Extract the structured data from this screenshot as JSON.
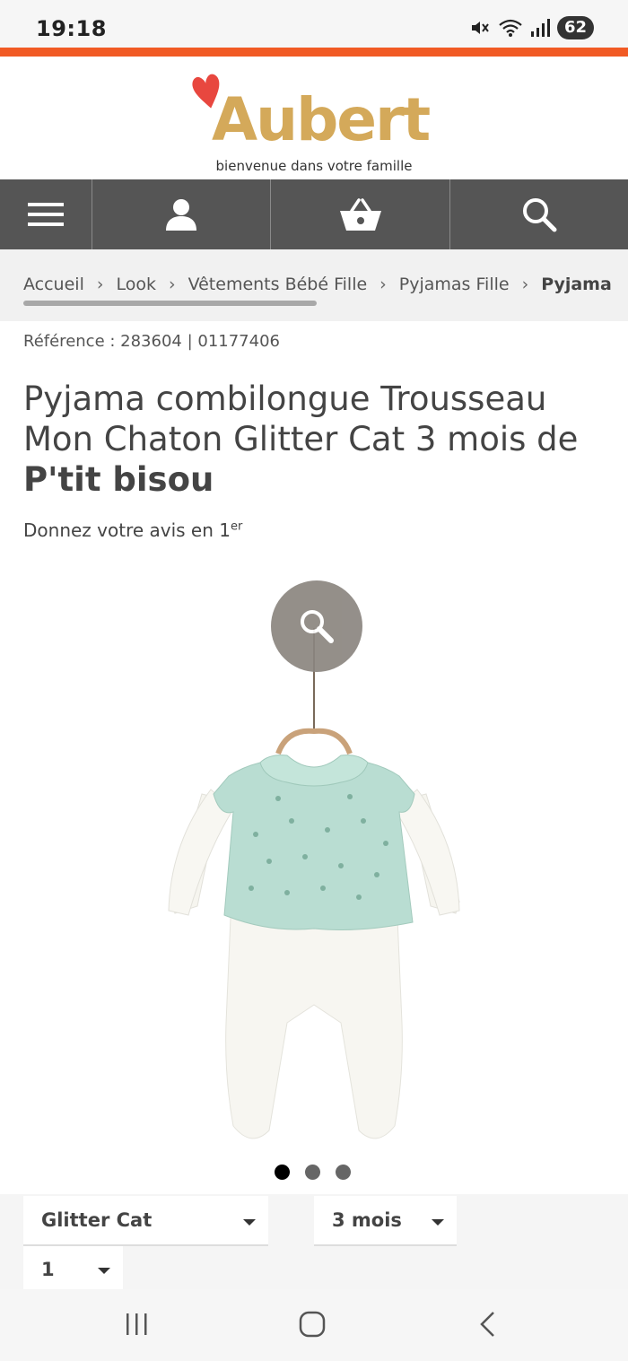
{
  "status": {
    "time": "19:18",
    "battery": "62"
  },
  "header": {
    "logo_text": "Aubert",
    "tagline": "bienvenue dans votre famille"
  },
  "nav": {
    "items": [
      {
        "icon": "menu-icon"
      },
      {
        "icon": "user-icon"
      },
      {
        "icon": "basket-icon"
      },
      {
        "icon": "search-icon"
      }
    ]
  },
  "breadcrumb": {
    "items": [
      "Accueil",
      "Look",
      "Vêtements Bébé Fille",
      "Pyjamas Fille"
    ],
    "current": "Pyjama",
    "separator": "›"
  },
  "product": {
    "reference": "Référence : 283604 | 01177406",
    "title": "Pyjama combilongue Trousseau Mon Chaton Glitter Cat 3 mois de",
    "brand": "P'tit bisou",
    "review_text": "Donnez votre avis en 1",
    "review_sup": "er",
    "image_count": 3,
    "active_image": 1
  },
  "options": {
    "color": "Glitter Cat",
    "size": "3 mois",
    "quantity": "1"
  },
  "colors": {
    "accent": "#f15a24",
    "nav_bg": "#555555",
    "logo": "#d4a95a",
    "heart": "#e8473f"
  }
}
